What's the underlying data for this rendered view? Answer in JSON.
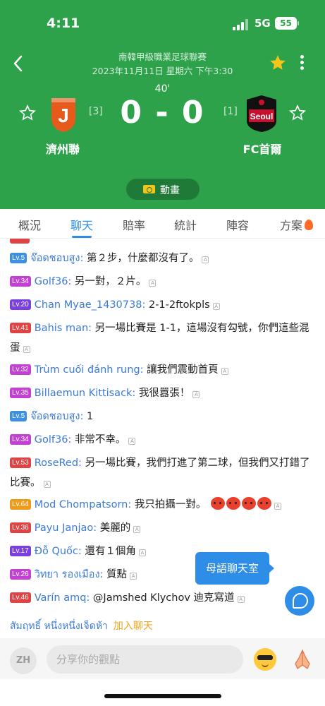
{
  "status_bar": {
    "time": "4:11",
    "network": "5G",
    "battery": "55"
  },
  "match": {
    "league": "南韓甲級職業足球聯賽",
    "date": "2023年11月11日 星期六 下午3:30",
    "minute": "40'",
    "score": "0 - 0",
    "home": {
      "name": "濟州聯",
      "rank": "[3]",
      "color": "#e85a1c"
    },
    "away": {
      "name": "FC首爾",
      "rank": "[1]",
      "color": "#c8102e"
    },
    "animation_label": "動畫"
  },
  "tabs": [
    "概況",
    "聊天",
    "賠率",
    "統計",
    "陣容",
    "方案"
  ],
  "active_tab": "聊天",
  "chat": [
    {
      "level": "",
      "user": "",
      "text": "",
      "partial": true
    },
    {
      "level": "Lv.5",
      "level_color": "#3d8fe0",
      "user": "จ๊อดชอบสูง:",
      "text": "第２步，什麼都沒有了。"
    },
    {
      "level": "Lv.34",
      "level_color": "#c43fd4",
      "user": "Golf36:",
      "text": "另一對，２片。"
    },
    {
      "level": "Lv.20",
      "level_color": "#7a3fe0",
      "user": "Chan Myae_1430738:",
      "text": "2-1-2ftokpls"
    },
    {
      "level": "Lv.41",
      "level_color": "#e04343",
      "user": "Bahis man:",
      "text": "另一場比賽是 1-1，這場沒有勾號，你們這些混蛋"
    },
    {
      "level": "Lv.32",
      "level_color": "#c43fd4",
      "user": "Trùm cuối đánh rung:",
      "text": "讓我們震動首頁"
    },
    {
      "level": "Lv.35",
      "level_color": "#c43fd4",
      "user": "Billaemun Kittisack:",
      "text": "我很囂張！"
    },
    {
      "level": "Lv.5",
      "level_color": "#3d8fe0",
      "user": "จ๊อดชอบสูง:",
      "text": "1"
    },
    {
      "level": "Lv.34",
      "level_color": "#c43fd4",
      "user": "Golf36:",
      "text": "非常不幸。"
    },
    {
      "level": "Lv.53",
      "level_color": "#e04343",
      "user": "RoseRed:",
      "text": "另一場比賽，我們打進了第二球，但我們又打錯了比賽。"
    },
    {
      "level": "Lv.64",
      "level_color": "#f09a1a",
      "user": "Mod Chompatsorn:",
      "text": "我只拍攝一對。"
    },
    {
      "level": "Lv.36",
      "level_color": "#e04343",
      "user": "Payu Janjao:",
      "text": "美麗的"
    },
    {
      "level": "Lv.17",
      "level_color": "#7a3fe0",
      "user": "Đỗ Quốc:",
      "text": "還有１個角"
    },
    {
      "level": "Lv.26",
      "level_color": "#c43fd4",
      "user": "วิทยา รองเมือง:",
      "text": "質點"
    },
    {
      "level": "Lv.46",
      "level_color": "#e04343",
      "user": "Varín amq:",
      "text": "@Jamshed Klychov 迪克寫道"
    }
  ],
  "translate_badge": "A",
  "lang_room_label": "母語聊天室",
  "join": {
    "user": "สัมฤทธิ์ หนึ่งหนึ่งเจ็ดห้า",
    "action": "加入聊天"
  },
  "input": {
    "lang": "ZH",
    "placeholder": "分享你的觀點"
  }
}
